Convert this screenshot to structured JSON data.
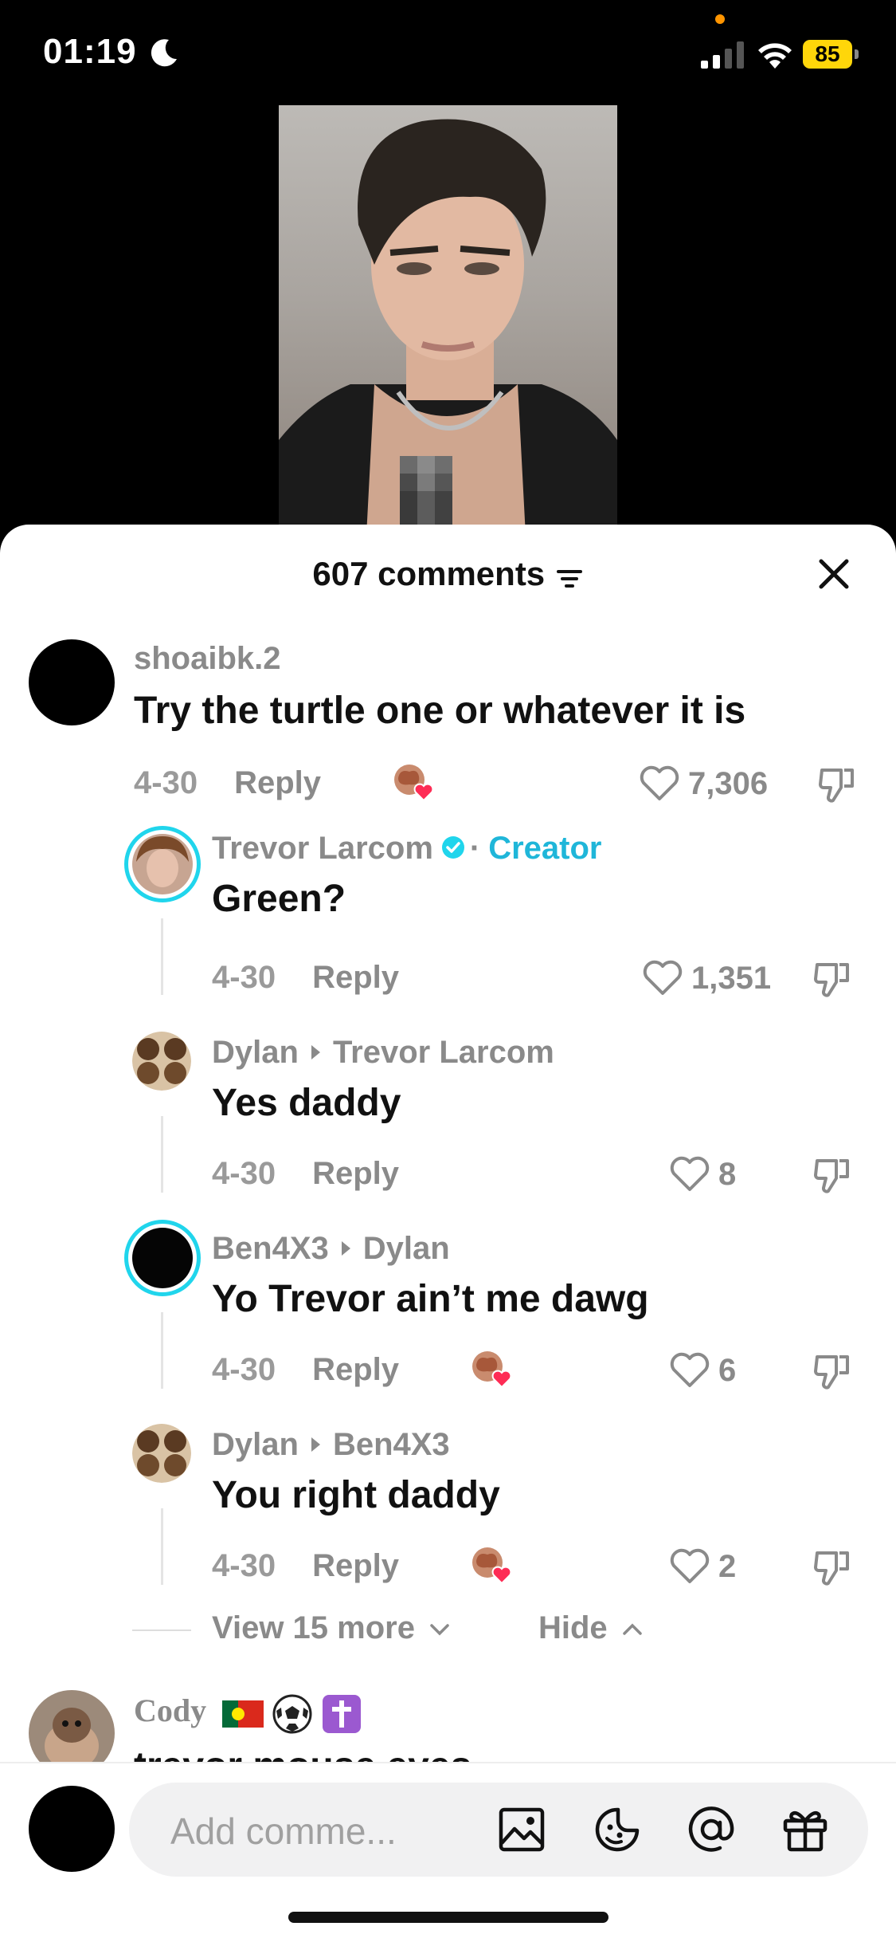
{
  "status_bar": {
    "time": "01:19",
    "battery": "85"
  },
  "sheet": {
    "title": "607 comments"
  },
  "comments": [
    {
      "username": "shoaibk.2",
      "text": "Try the turtle one or whatever it is",
      "date": "4-30",
      "reply_label": "Reply",
      "likes": "7,306"
    },
    {
      "username": "Trevor Larcom",
      "creator_label": "Creator",
      "separator": "·",
      "text": "Green?",
      "date": "4-30",
      "reply_label": "Reply",
      "likes": "1,351"
    },
    {
      "username": "Dylan",
      "reply_to": "Trevor Larcom",
      "text": "Yes daddy",
      "date": "4-30",
      "reply_label": "Reply",
      "likes": "8"
    },
    {
      "username": "Ben4X3",
      "reply_to": "Dylan",
      "text": "Yo Trevor ain’t me dawg",
      "date": "4-30",
      "reply_label": "Reply",
      "likes": "6"
    },
    {
      "username": "Dylan",
      "reply_to": "Ben4X3",
      "text": "You right daddy",
      "date": "4-30",
      "reply_label": "Reply",
      "likes": "2"
    }
  ],
  "thread_controls": {
    "view_more": "View 15 more",
    "hide": "Hide"
  },
  "next_comment": {
    "username": "Cody",
    "text_partial": "trevor mouse eyes"
  },
  "composer": {
    "placeholder": "Add comme..."
  },
  "colors": {
    "creator_accent": "#1fb6d9",
    "heart_red": "#fe2c55",
    "battery_yellow": "#ffd60a"
  }
}
